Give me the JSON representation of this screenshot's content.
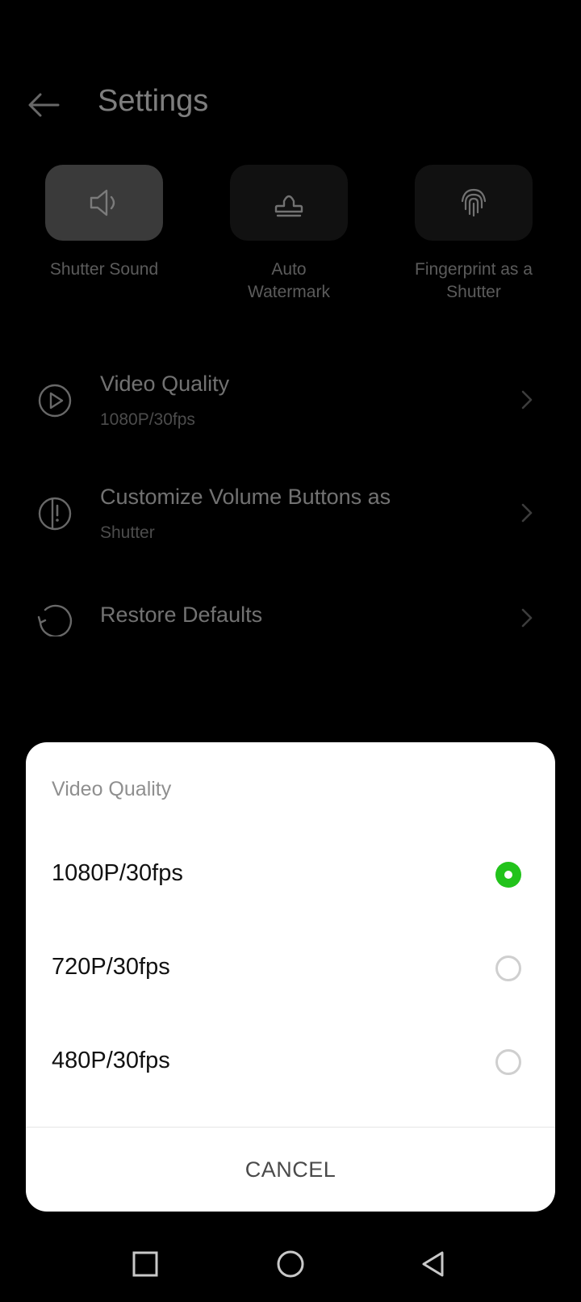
{
  "header": {
    "title": "Settings"
  },
  "quick_toggles": [
    {
      "label": "Shutter Sound",
      "icon": "speaker-icon",
      "active": true
    },
    {
      "label": "Auto Watermark",
      "icon": "stamp-icon",
      "active": false
    },
    {
      "label": "Fingerprint as a Shutter",
      "icon": "fingerprint-icon",
      "active": false
    }
  ],
  "settings_rows": [
    {
      "title": "Video Quality",
      "subtitle": "1080P/30fps",
      "icon": "play-circle-icon"
    },
    {
      "title": "Customize Volume Buttons as",
      "subtitle": "Shutter",
      "icon": "volume-buttons-icon"
    },
    {
      "title": "Restore Defaults",
      "subtitle": "",
      "icon": "restore-icon"
    }
  ],
  "dialog": {
    "title": "Video Quality",
    "options": [
      {
        "label": "1080P/30fps",
        "selected": true
      },
      {
        "label": "720P/30fps",
        "selected": false
      },
      {
        "label": "480P/30fps",
        "selected": false
      }
    ],
    "cancel_label": "CANCEL"
  },
  "colors": {
    "accent": "#22c31b",
    "background": "#000000",
    "dialog_bg": "#ffffff"
  }
}
